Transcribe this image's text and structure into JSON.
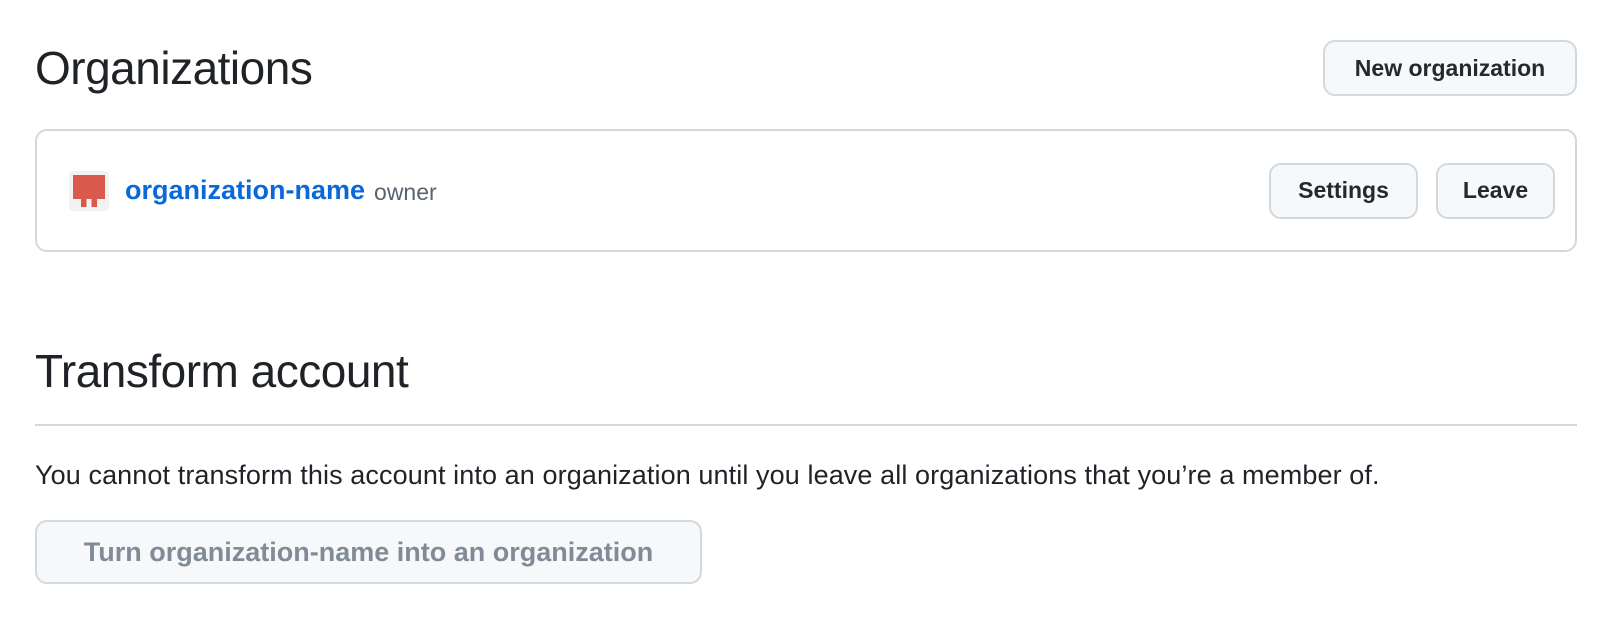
{
  "organizations": {
    "title": "Organizations",
    "new_button_label": "New organization",
    "items": [
      {
        "name": "organization-name",
        "role": "owner",
        "settings_label": "Settings",
        "leave_label": "Leave"
      }
    ]
  },
  "transform": {
    "title": "Transform account",
    "description": "You cannot transform this account into an organization until you leave all organizations that you’re a member of.",
    "button_label": "Turn organization-name into an organization"
  },
  "colors": {
    "link": "#0969da",
    "avatar": "#d9594c",
    "border": "#d1d9e0",
    "button_bg": "#f6f8fa"
  },
  "icons": {
    "avatar": "identicon-avatar"
  }
}
